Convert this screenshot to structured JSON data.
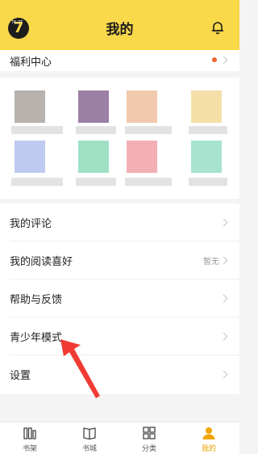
{
  "header": {
    "title": "我的",
    "logo_text": "7",
    "logo_badge": "7K.7T"
  },
  "welfare": {
    "label": "福利中心"
  },
  "menu": {
    "items": [
      {
        "label": "我的评论",
        "hint": ""
      },
      {
        "label": "我的阅读喜好",
        "hint": "暂无"
      },
      {
        "label": "帮助与反馈",
        "hint": ""
      },
      {
        "label": "青少年模式",
        "hint": ""
      },
      {
        "label": "设置",
        "hint": ""
      }
    ]
  },
  "tabbar": {
    "tabs": [
      {
        "label": "书架",
        "icon": "bookshelf-icon"
      },
      {
        "label": "书城",
        "icon": "book-store-icon"
      },
      {
        "label": "分类",
        "icon": "category-grid-icon"
      },
      {
        "label": "我的",
        "icon": "profile-icon"
      }
    ],
    "active_index": 3
  },
  "colors": {
    "header": "#f9d84a",
    "accent": "#f0a500",
    "badge": "#f0642c",
    "arrow": "#ef3b33"
  }
}
